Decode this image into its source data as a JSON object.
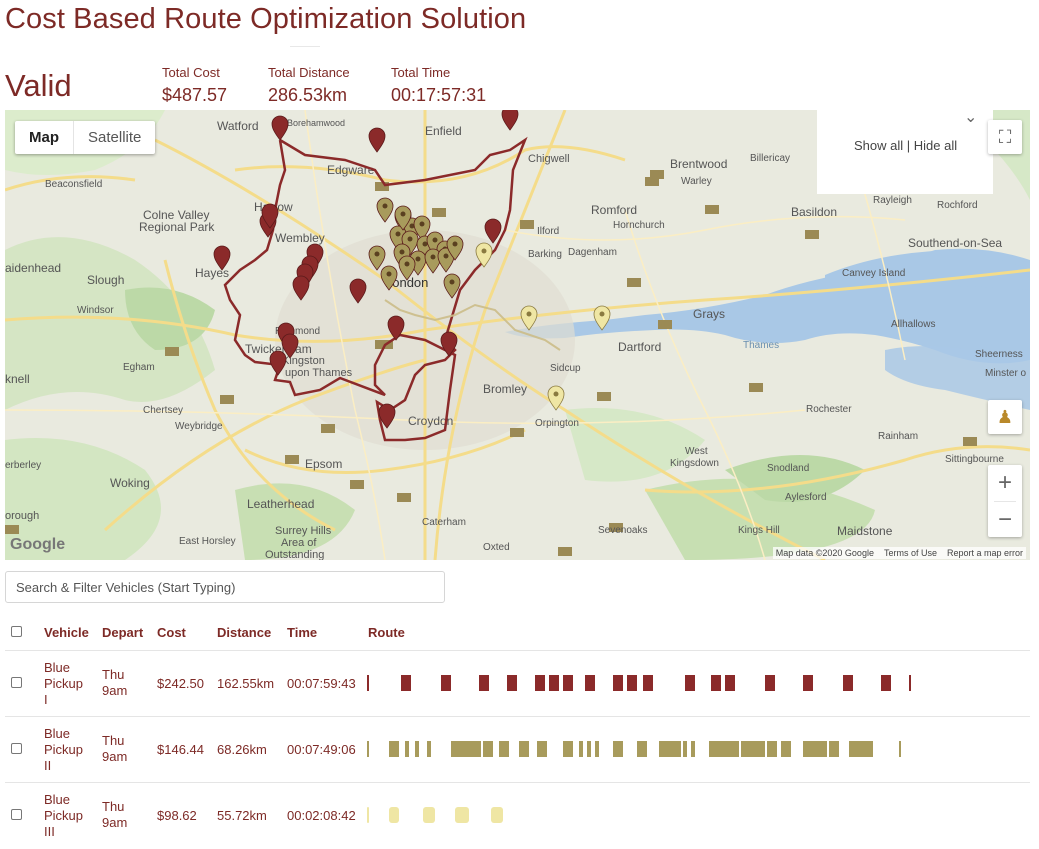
{
  "page": {
    "title": "Cost Based Route Optimization Solution",
    "status": "Valid"
  },
  "stats": [
    {
      "label": "Total Cost",
      "value": "$487.57"
    },
    {
      "label": "Total Distance",
      "value": "286.53km"
    },
    {
      "label": "Total Time",
      "value": "00:17:57:31"
    }
  ],
  "map": {
    "type_buttons": {
      "map": "Map",
      "satellite": "Satellite"
    },
    "legend_links": "Show all | Hide all",
    "attribution": {
      "data": "Map data ©2020 Google",
      "terms": "Terms of Use",
      "report": "Report a map error"
    },
    "google_logo": "Google",
    "zoom_in": "+",
    "zoom_out": "−",
    "places": [
      {
        "name": "Watford"
      },
      {
        "name": "Borehamwood"
      },
      {
        "name": "Enfield"
      },
      {
        "name": "Chigwell"
      },
      {
        "name": "Brentwood"
      },
      {
        "name": "Billericay"
      },
      {
        "name": "Warley"
      },
      {
        "name": "Edgware"
      },
      {
        "name": "Beaconsfield"
      },
      {
        "name": "Harrow"
      },
      {
        "name": "Romford"
      },
      {
        "name": "Hornchurch"
      },
      {
        "name": "Basildon"
      },
      {
        "name": "Rayleigh"
      },
      {
        "name": "Rochford"
      },
      {
        "name": "Colne Valley"
      },
      {
        "name": "Regional Park"
      },
      {
        "name": "Wembley"
      },
      {
        "name": "Ilford"
      },
      {
        "name": "Barking"
      },
      {
        "name": "Dagenham"
      },
      {
        "name": "Southend-on-Sea"
      },
      {
        "name": "aidenhead"
      },
      {
        "name": "Slough"
      },
      {
        "name": "Hayes"
      },
      {
        "name": "London"
      },
      {
        "name": "Canvey Island"
      },
      {
        "name": "Windsor"
      },
      {
        "name": "Richmond"
      },
      {
        "name": "Grays"
      },
      {
        "name": "Dartford"
      },
      {
        "name": "Allhallows"
      },
      {
        "name": "Twickenham"
      },
      {
        "name": "Egham"
      },
      {
        "name": "Kingston"
      },
      {
        "name": "upon Thames"
      },
      {
        "name": "Sidcup"
      },
      {
        "name": "Sheerness"
      },
      {
        "name": "Minster o"
      },
      {
        "name": "knell"
      },
      {
        "name": "Bromley"
      },
      {
        "name": "Chertsey"
      },
      {
        "name": "Weybridge"
      },
      {
        "name": "Croydon"
      },
      {
        "name": "Orpington"
      },
      {
        "name": "Rochester"
      },
      {
        "name": "Rainham"
      },
      {
        "name": "West"
      },
      {
        "name": "Kingsdown"
      },
      {
        "name": "Sittingbourne"
      },
      {
        "name": "erberley"
      },
      {
        "name": "Epsom"
      },
      {
        "name": "Snodland"
      },
      {
        "name": "Woking"
      },
      {
        "name": "Aylesford"
      },
      {
        "name": "Leatherhead"
      },
      {
        "name": "Kings Hill"
      },
      {
        "name": "Maidstone"
      },
      {
        "name": "orough"
      },
      {
        "name": "Surrey Hills"
      },
      {
        "name": "Area of"
      },
      {
        "name": "Outstanding"
      },
      {
        "name": "Sevenoaks"
      },
      {
        "name": "Caterham"
      },
      {
        "name": "East Horsley"
      },
      {
        "name": "Oxted"
      },
      {
        "name": "Thames"
      }
    ]
  },
  "search": {
    "placeholder": "Search & Filter Vehicles (Start Typing)"
  },
  "table": {
    "headers": {
      "vehicle": "Vehicle",
      "depart": "Depart",
      "cost": "Cost",
      "distance": "Distance",
      "time": "Time",
      "route": "Route"
    },
    "rows": [
      {
        "vehicle": [
          "Blue",
          "Pickup",
          "I"
        ],
        "depart": [
          "Thu",
          "9am"
        ],
        "cost": "$242.50",
        "distance": "162.55km",
        "time": "00:07:59:43",
        "color": "#8b2a2a"
      },
      {
        "vehicle": [
          "Blue",
          "Pickup",
          "II"
        ],
        "depart": [
          "Thu",
          "9am"
        ],
        "cost": "$146.44",
        "distance": "68.26km",
        "time": "00:07:49:06",
        "color": "#a89b5c"
      },
      {
        "vehicle": [
          "Blue",
          "Pickup",
          "III"
        ],
        "depart": [
          "Thu",
          "9am"
        ],
        "cost": "$98.62",
        "distance": "55.72km",
        "time": "00:02:08:42",
        "color": "#efe6a4"
      }
    ]
  },
  "colors": {
    "accent": "#7d2a26",
    "route_1": "#8b2a2a",
    "route_2": "#a89b5c",
    "route_3": "#efe6a4"
  }
}
